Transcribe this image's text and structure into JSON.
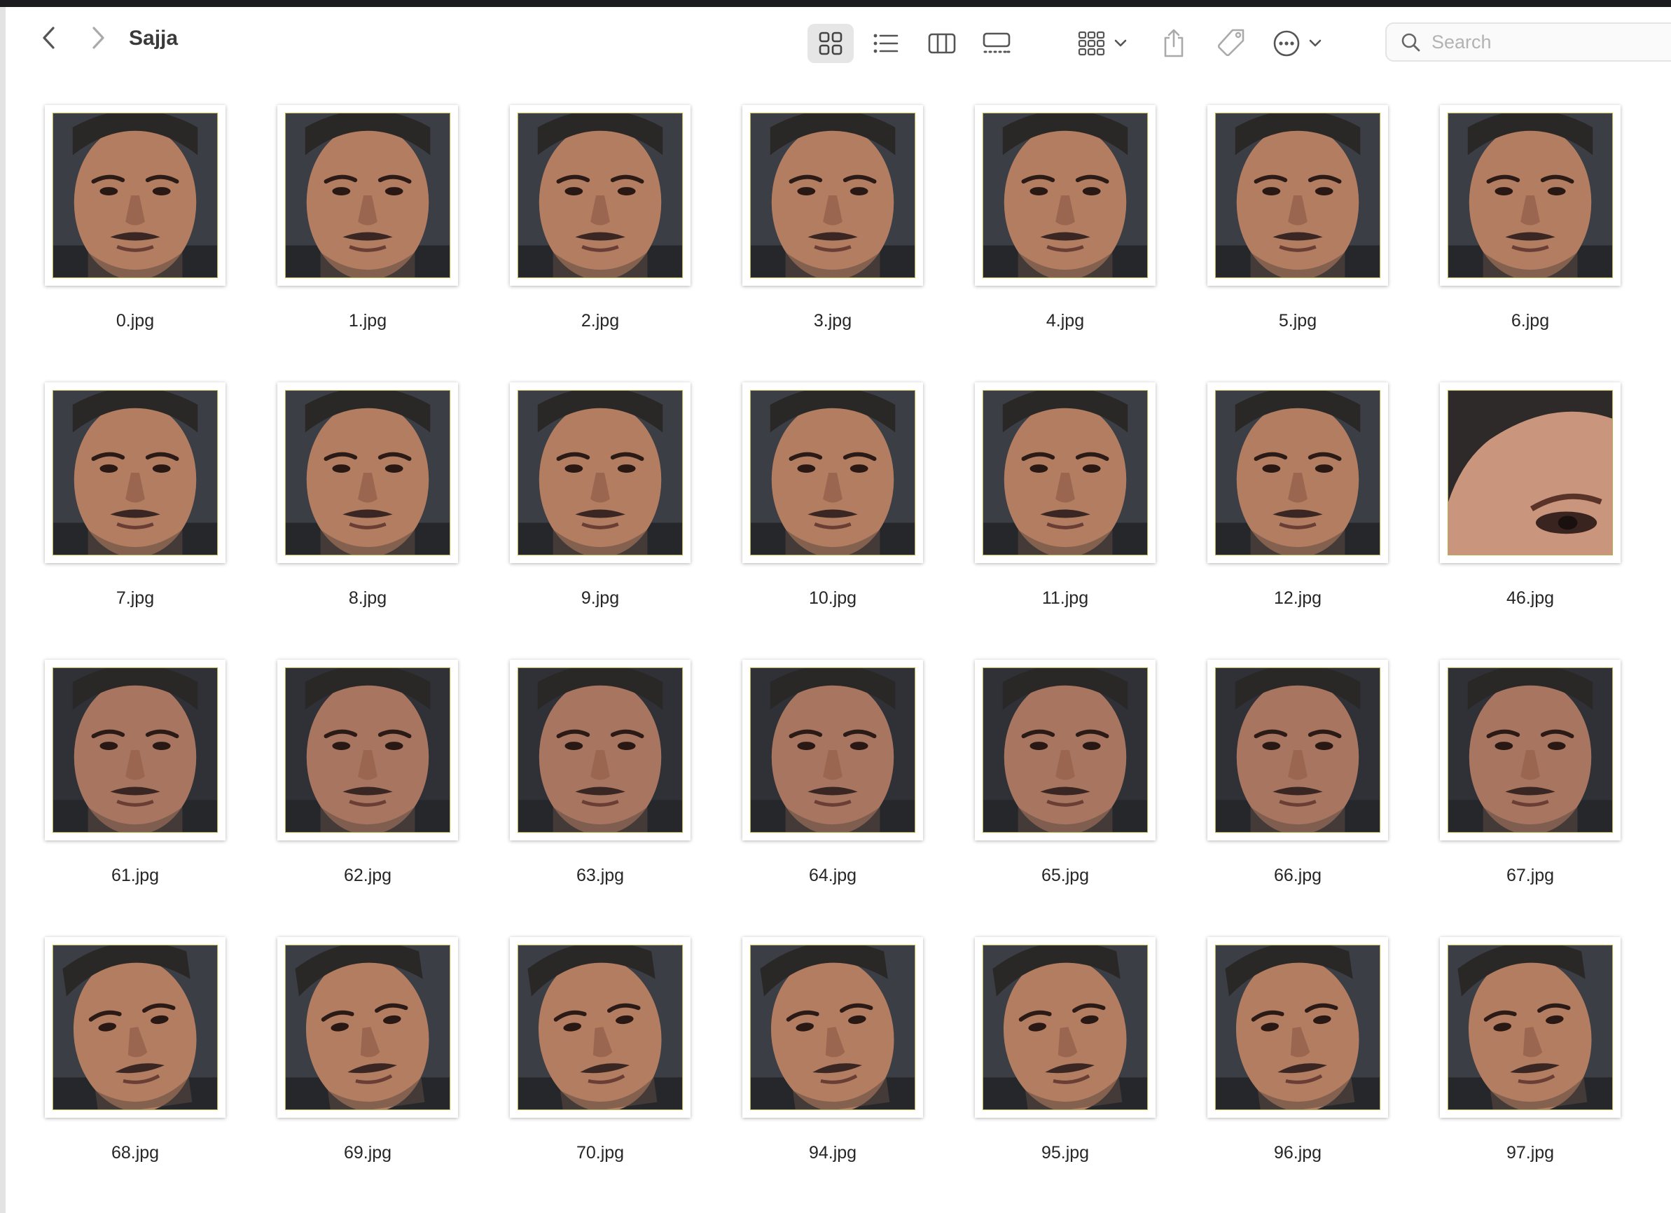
{
  "window": {
    "title": "Sajja"
  },
  "toolbar": {
    "back_icon": "chevron-left-icon",
    "forward_icon": "chevron-right-icon",
    "views": [
      "icon-view",
      "list-view",
      "column-view",
      "gallery-view"
    ],
    "active_view": "icon-view",
    "group_icon": "group-grid-icon",
    "share_icon": "share-icon",
    "tag_icon": "tag-icon",
    "more_icon": "ellipsis-circle-icon"
  },
  "search": {
    "placeholder": "Search"
  },
  "colors": {
    "accent_border": "#b6b04a",
    "selected_view_bg": "#e6e6e6"
  },
  "files": {
    "row1": [
      {
        "name": "0.jpg",
        "thumb": "face"
      },
      {
        "name": "1.jpg",
        "thumb": "face"
      },
      {
        "name": "2.jpg",
        "thumb": "face"
      },
      {
        "name": "3.jpg",
        "thumb": "face"
      },
      {
        "name": "4.jpg",
        "thumb": "face"
      },
      {
        "name": "5.jpg",
        "thumb": "face"
      },
      {
        "name": "6.jpg",
        "thumb": "face"
      }
    ],
    "row2": [
      {
        "name": "7.jpg",
        "thumb": "face"
      },
      {
        "name": "8.jpg",
        "thumb": "face"
      },
      {
        "name": "9.jpg",
        "thumb": "face"
      },
      {
        "name": "10.jpg",
        "thumb": "face"
      },
      {
        "name": "11.jpg",
        "thumb": "face"
      },
      {
        "name": "12.jpg",
        "thumb": "face"
      },
      {
        "name": "46.jpg",
        "thumb": "closeup"
      }
    ],
    "row3": [
      {
        "name": "61.jpg",
        "thumb": "face-dark"
      },
      {
        "name": "62.jpg",
        "thumb": "face-dark"
      },
      {
        "name": "63.jpg",
        "thumb": "face-dark"
      },
      {
        "name": "64.jpg",
        "thumb": "face-dark"
      },
      {
        "name": "65.jpg",
        "thumb": "face-dark"
      },
      {
        "name": "66.jpg",
        "thumb": "face-dark"
      },
      {
        "name": "67.jpg",
        "thumb": "face-dark"
      }
    ],
    "row4": [
      {
        "name": "68.jpg",
        "thumb": "face-tilt"
      },
      {
        "name": "69.jpg",
        "thumb": "face-tilt"
      },
      {
        "name": "70.jpg",
        "thumb": "face-tilt"
      },
      {
        "name": "94.jpg",
        "thumb": "face-tilt"
      },
      {
        "name": "95.jpg",
        "thumb": "face-tilt"
      },
      {
        "name": "96.jpg",
        "thumb": "face-tilt"
      },
      {
        "name": "97.jpg",
        "thumb": "face-tilt"
      }
    ]
  }
}
